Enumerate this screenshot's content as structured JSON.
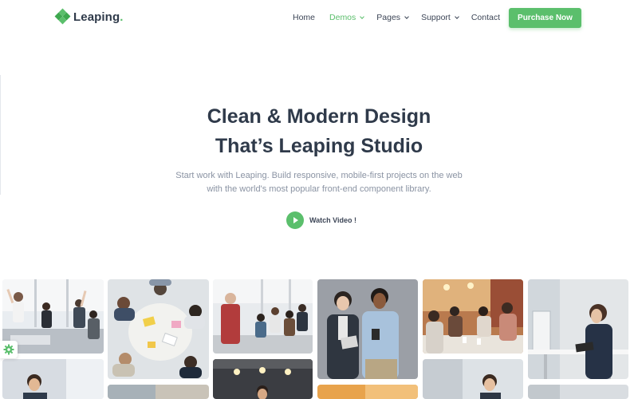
{
  "brand": {
    "name": "Leaping",
    "dot": "."
  },
  "nav": {
    "items": [
      {
        "label": "Home",
        "dropdown": false,
        "active": false
      },
      {
        "label": "Demos",
        "dropdown": true,
        "active": true
      },
      {
        "label": "Pages",
        "dropdown": true,
        "active": false
      },
      {
        "label": "Support",
        "dropdown": true,
        "active": false
      },
      {
        "label": "Contact",
        "dropdown": false,
        "active": false
      }
    ],
    "cta_label": "Purchase Now"
  },
  "hero": {
    "title_line1": "Clean & Modern Design",
    "title_line2": "That’s Leaping Studio",
    "subtitle_line1": "Start work with Leaping. Build responsive, mobile-first projects on the web",
    "subtitle_line2": "with the world's most popular front-end component library.",
    "watch_label": "Watch Video !"
  },
  "gallery": {
    "images": [
      "office-team-celebrating-photo",
      "team-meeting-overhead-photo",
      "presentation-to-audience-photo",
      "two-colleagues-with-tablet-photo",
      "cafe-team-discussion-photo",
      "woman-at-standing-desk-photo",
      "man-with-laptop-photo",
      "workshop-under-lights-photo",
      "office-interior-photo",
      "woman-at-meeting-photo",
      "office-space-photo"
    ]
  },
  "colors": {
    "accent": "#5bbf6c",
    "heading": "#2f3a4a",
    "muted": "#8a93a3"
  },
  "icons": {
    "settings": "gear-icon",
    "play": "play-icon",
    "logo": "diamond-logo-icon"
  }
}
